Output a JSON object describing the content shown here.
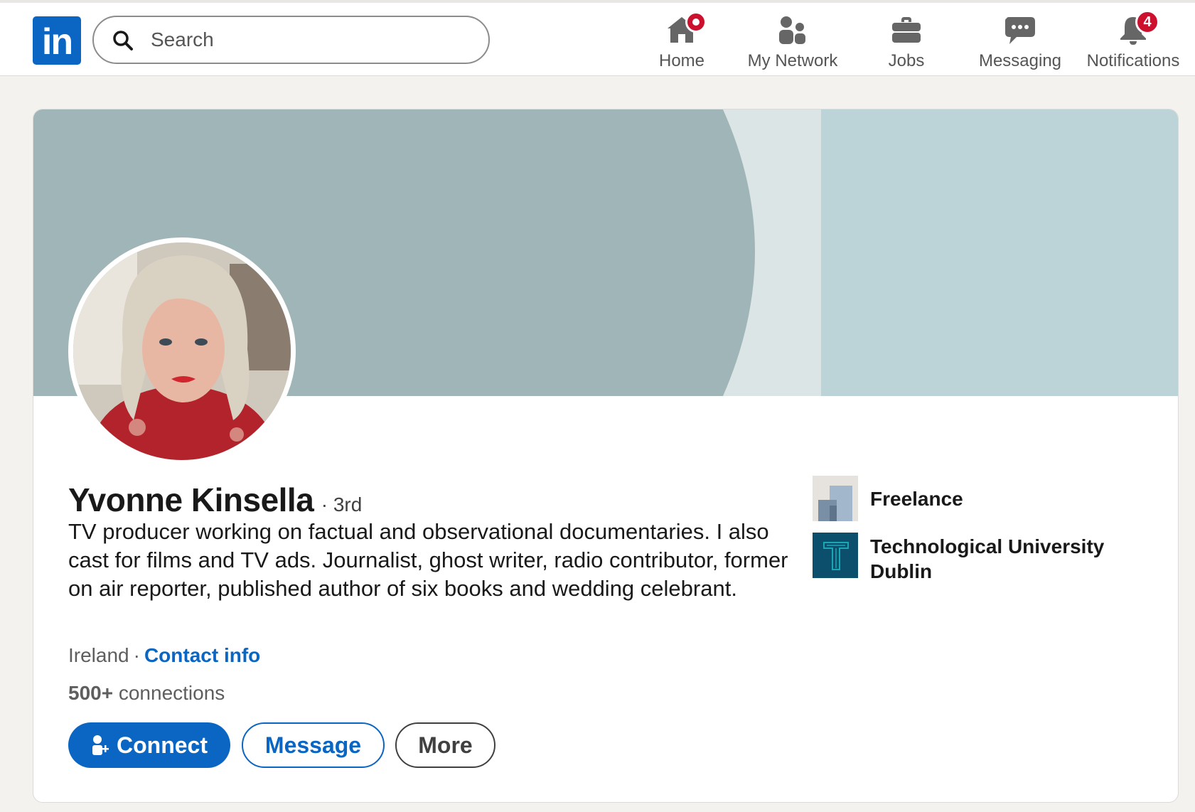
{
  "nav": {
    "search_placeholder": "Search",
    "items": [
      {
        "label": "Home",
        "icon": "home-icon",
        "badge": "dot"
      },
      {
        "label": "My Network",
        "icon": "my-network-icon"
      },
      {
        "label": "Jobs",
        "icon": "briefcase-icon"
      },
      {
        "label": "Messaging",
        "icon": "messaging-icon"
      },
      {
        "label": "Notifications",
        "icon": "bell-icon",
        "badge_count": "4"
      }
    ]
  },
  "profile": {
    "name": "Yvonne Kinsella",
    "degree": "· 3rd",
    "headline": "TV producer working on factual and observational documentaries. I also cast for films and TV ads. Journalist, ghost writer, radio contributor, former on air reporter, published author of six books and wedding celebrant.",
    "location": "Ireland",
    "separator": "·",
    "contact_info_label": "Contact info",
    "connections_count": "500+",
    "connections_label": "connections",
    "actions": {
      "connect": "Connect",
      "message": "Message",
      "more": "More"
    },
    "organizations": [
      {
        "name": "Freelance",
        "logo": "freelance-logo"
      },
      {
        "name": "Technological University Dublin",
        "logo": "tu-dublin-logo"
      }
    ]
  },
  "colors": {
    "brand_blue": "#0a66c2",
    "notification_red": "#cb112d",
    "banner_main": "#a0b5b7",
    "banner_light": "#dbe5e6",
    "banner_right": "#bcd4d7",
    "page_bg": "#f4f2ee"
  }
}
